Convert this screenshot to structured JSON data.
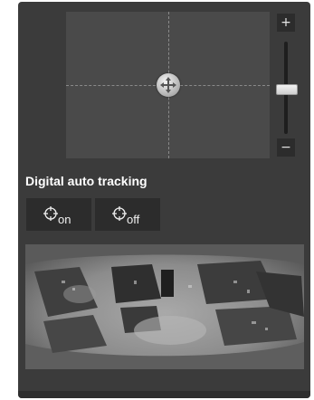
{
  "ptz": {
    "handle_icon": "move-arrows-icon"
  },
  "zoom": {
    "in_label": "+",
    "out_label": "−"
  },
  "tracking": {
    "title": "Digital auto tracking",
    "on_label": "on",
    "off_label": "off",
    "icon": "crosshair-icon"
  },
  "colors": {
    "panel": "#3b3b3b",
    "pad": "#4a4a4a",
    "button": "#2c2c2c"
  }
}
